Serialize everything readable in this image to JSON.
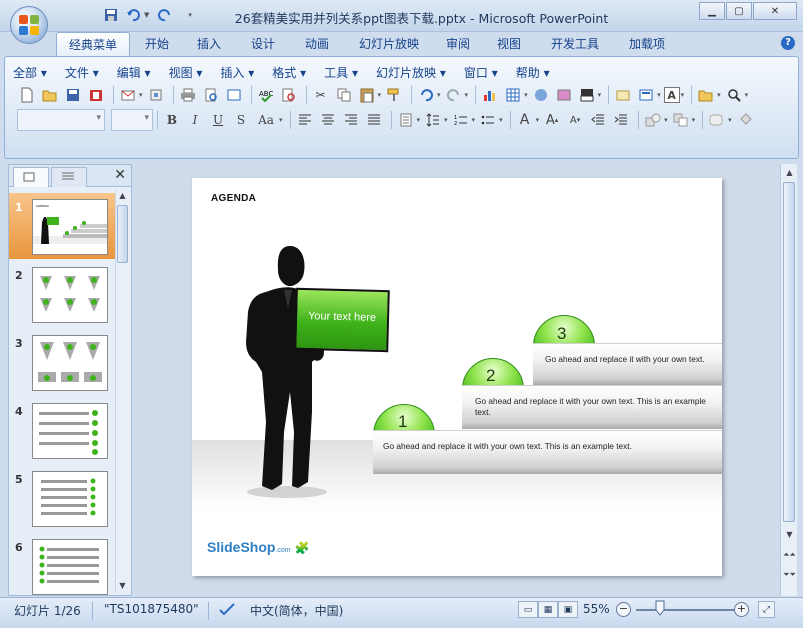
{
  "window": {
    "title": "26套精美实用并列关系ppt图表下载.pptx - Microsoft PowerPoint",
    "controls": [
      "minimize",
      "maximize",
      "close"
    ]
  },
  "ribbon_tabs": [
    "经典菜单",
    "开始",
    "插入",
    "设计",
    "动画",
    "幻灯片放映",
    "审阅",
    "视图",
    "开发工具",
    "加载项"
  ],
  "active_tab": "经典菜单",
  "classic_menu": [
    "全部",
    "文件",
    "编辑",
    "视图",
    "插入",
    "格式",
    "工具",
    "幻灯片放映",
    "窗口",
    "帮助"
  ],
  "format_buttons": {
    "bold": "B",
    "italic": "I",
    "underline": "U",
    "shadow": "S",
    "change_case": "Aa"
  },
  "font_color_letter": "A",
  "slides_pane": {
    "tabs": [
      "slides",
      "outline"
    ],
    "close": "✕",
    "thumbnails": [
      {
        "number": "1",
        "selected": true
      },
      {
        "number": "2",
        "selected": false
      },
      {
        "number": "3",
        "selected": false
      },
      {
        "number": "4",
        "selected": false
      },
      {
        "number": "5",
        "selected": false
      },
      {
        "number": "6",
        "selected": false
      }
    ]
  },
  "slide": {
    "heading": "AGENDA",
    "sign_text": "Your text here",
    "steps": [
      {
        "number": "1",
        "text": "Go ahead and replace it with your own text. This is an example text."
      },
      {
        "number": "2",
        "text": "Go ahead and replace it with your own text. This is an example text."
      },
      {
        "number": "3",
        "text": "Go ahead and replace it with your own text."
      }
    ],
    "logo": "SlideShop",
    "logo_suffix": ".com"
  },
  "status": {
    "slide_info": "幻灯片 1/26",
    "theme": "\"TS101875480\"",
    "language": "中文(简体，中国)",
    "zoom": "55%"
  },
  "colors": {
    "accent_green": "#3fb31b",
    "selection_orange": "#e8963b",
    "ribbon_blue": "#15428b"
  }
}
